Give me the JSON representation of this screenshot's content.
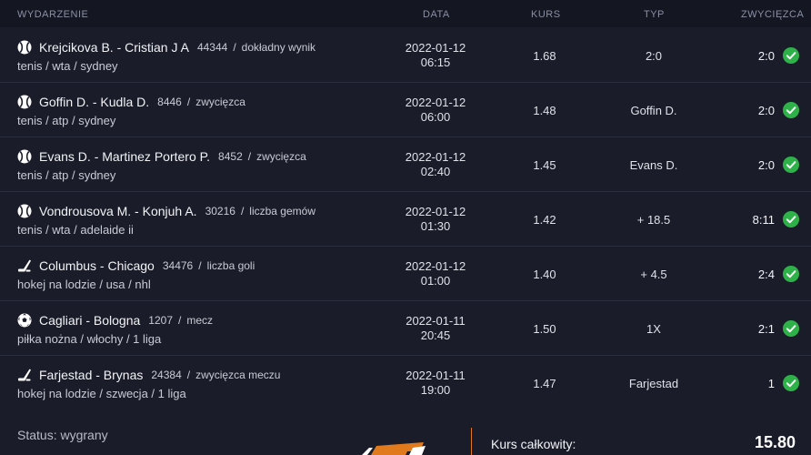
{
  "header": {
    "event": "WYDARZENIE",
    "date": "DATA",
    "odds": "KURS",
    "type": "TYP",
    "winner": "ZWYCIĘZCA"
  },
  "rows": [
    {
      "sport": "tennis",
      "name": "Krejcikova B. - Cristian J A",
      "id": "44344",
      "market": "dokładny wynik",
      "path": "tenis / wta / sydney",
      "date": "2022-01-12",
      "time": "06:15",
      "odds": "1.68",
      "type": "2:0",
      "score": "2:0"
    },
    {
      "sport": "tennis",
      "name": "Goffin D. - Kudla D.",
      "id": "8446",
      "market": "zwycięzca",
      "path": "tenis / atp / sydney",
      "date": "2022-01-12",
      "time": "06:00",
      "odds": "1.48",
      "type": "Goffin D.",
      "score": "2:0"
    },
    {
      "sport": "tennis",
      "name": "Evans D. - Martinez Portero P.",
      "id": "8452",
      "market": "zwycięzca",
      "path": "tenis / atp / sydney",
      "date": "2022-01-12",
      "time": "02:40",
      "odds": "1.45",
      "type": "Evans D.",
      "score": "2:0"
    },
    {
      "sport": "tennis",
      "name": "Vondrousova M. - Konjuh A.",
      "id": "30216",
      "market": "liczba gemów",
      "path": "tenis / wta / adelaide ii",
      "date": "2022-01-12",
      "time": "01:30",
      "odds": "1.42",
      "type": "+ 18.5",
      "score": "8:11"
    },
    {
      "sport": "hockey",
      "name": "Columbus - Chicago",
      "id": "34476",
      "market": "liczba goli",
      "path": "hokej na lodzie / usa / nhl",
      "date": "2022-01-12",
      "time": "01:00",
      "odds": "1.40",
      "type": "+ 4.5",
      "score": "2:4"
    },
    {
      "sport": "football",
      "name": "Cagliari - Bologna",
      "id": "1207",
      "market": "mecz",
      "path": "piłka nożna / włochy / 1 liga",
      "date": "2022-01-11",
      "time": "20:45",
      "odds": "1.50",
      "type": "1X",
      "score": "2:1"
    },
    {
      "sport": "hockey",
      "name": "Farjestad - Brynas",
      "id": "24384",
      "market": "zwycięzca meczu",
      "path": "hokej na lodzie / szwecja / 1 liga",
      "date": "2022-01-11",
      "time": "19:00",
      "odds": "1.47",
      "type": "Farjestad",
      "score": "1"
    }
  ],
  "footer": {
    "status": "Status: wygrany",
    "total_label": "Kurs całkowity:",
    "total_value": "15.80"
  },
  "colors": {
    "accent": "#e07a1c",
    "win": "#2fb14a",
    "bg": "#1a1d29",
    "header_bg": "#141722"
  }
}
